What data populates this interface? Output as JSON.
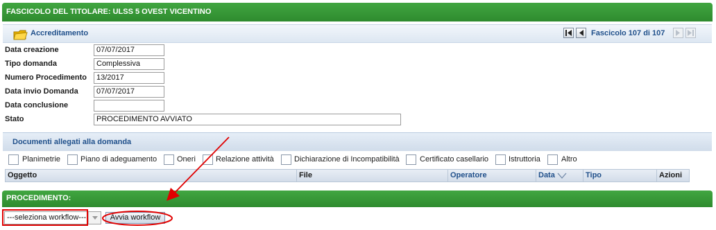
{
  "header": {
    "title": "FASCICOLO DEL TITOLARE: ULSS 5 OVEST VICENTINO"
  },
  "section": {
    "title": "Accreditamento",
    "icon": "folder-icon",
    "pager": {
      "text": "Fascicolo 107 di 107",
      "first_icon": "first-page-icon",
      "prev_icon": "prev-page-icon",
      "next_icon": "next-page-icon",
      "last_icon": "last-page-icon"
    }
  },
  "form": {
    "data_creazione": {
      "label": "Data creazione",
      "value": "07/07/2017"
    },
    "tipo_domanda": {
      "label": "Tipo domanda",
      "value": "Complessiva"
    },
    "numero_procedimento": {
      "label": "Numero Procedimento",
      "value": "13/2017"
    },
    "data_invio": {
      "label": "Data invio Domanda",
      "value": "07/07/2017"
    },
    "data_conclusione": {
      "label": "Data conclusione",
      "value": ""
    },
    "stato": {
      "label": "Stato",
      "value": "PROCEDIMENTO AVVIATO"
    }
  },
  "documents": {
    "title": "Documenti allegati alla domanda",
    "filters": [
      "Planimetrie",
      "Piano di adeguamento",
      "Oneri",
      "Relazione attività",
      "Dichiarazione di Incompatibilità",
      "Certificato casellario",
      "Istruttoria",
      "Altro"
    ],
    "columns": [
      "Oggetto",
      "File",
      "Operatore",
      "Data",
      "Tipo",
      "Azioni"
    ]
  },
  "procedimento": {
    "title": "PROCEDIMENTO:",
    "select_value": "---seleziona workflow---",
    "button_label": "Avvia workflow"
  },
  "colors": {
    "green_header": "#2e8b2e",
    "blue_text": "#1f4f8a",
    "annotation_red": "#e00000"
  }
}
